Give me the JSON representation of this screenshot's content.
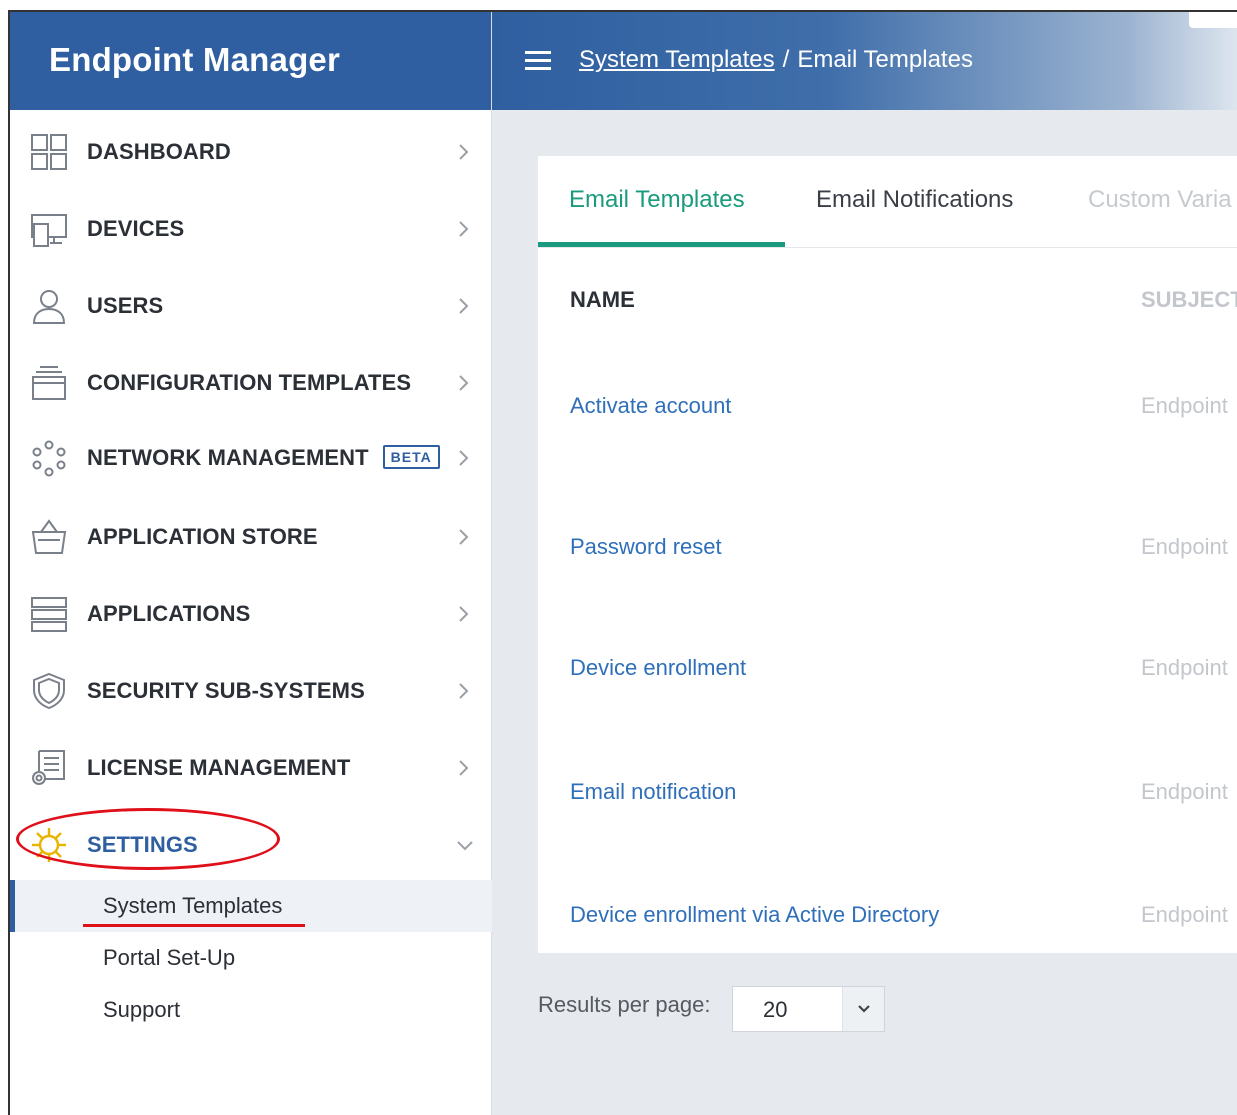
{
  "app_title": "Endpoint Manager",
  "breadcrumb": {
    "parent": "System Templates",
    "separator": "/",
    "current": "Email Templates"
  },
  "sidebar": {
    "items": [
      {
        "label": "DASHBOARD",
        "icon": "dashboard-icon"
      },
      {
        "label": "DEVICES",
        "icon": "devices-icon"
      },
      {
        "label": "USERS",
        "icon": "user-icon"
      },
      {
        "label": "CONFIGURATION TEMPLATES",
        "icon": "layers-icon"
      },
      {
        "label": "NETWORK MANAGEMENT",
        "icon": "network-icon",
        "badge": "BETA"
      },
      {
        "label": "APPLICATION STORE",
        "icon": "store-basket-icon"
      },
      {
        "label": "APPLICATIONS",
        "icon": "applications-icon"
      },
      {
        "label": "SECURITY SUB-SYSTEMS",
        "icon": "shield-icon"
      },
      {
        "label": "LICENSE MANAGEMENT",
        "icon": "license-icon"
      },
      {
        "label": "SETTINGS",
        "icon": "gear-icon",
        "expanded": true
      }
    ],
    "settings_children": [
      "System Templates",
      "Portal Set-Up",
      "Support"
    ]
  },
  "tabs": [
    "Email Templates",
    "Email Notifications",
    "Custom Varia"
  ],
  "table": {
    "headers": {
      "name": "NAME",
      "subject": "SUBJECT"
    },
    "rows": [
      {
        "name": "Activate account",
        "subject": "Endpoint"
      },
      {
        "name": "Password reset",
        "subject": "Endpoint"
      },
      {
        "name": "Device enrollment",
        "subject": "Endpoint"
      },
      {
        "name": "Email notification",
        "subject": "Endpoint"
      },
      {
        "name": "Device enrollment via Active Directory",
        "subject": "Endpoint"
      }
    ]
  },
  "pagination": {
    "label": "Results per page:",
    "value": "20"
  },
  "colors": {
    "brand": "#2f5fa0",
    "accent": "#1a9b7d",
    "link": "#2f6fba",
    "annotation": "#e0101a"
  }
}
